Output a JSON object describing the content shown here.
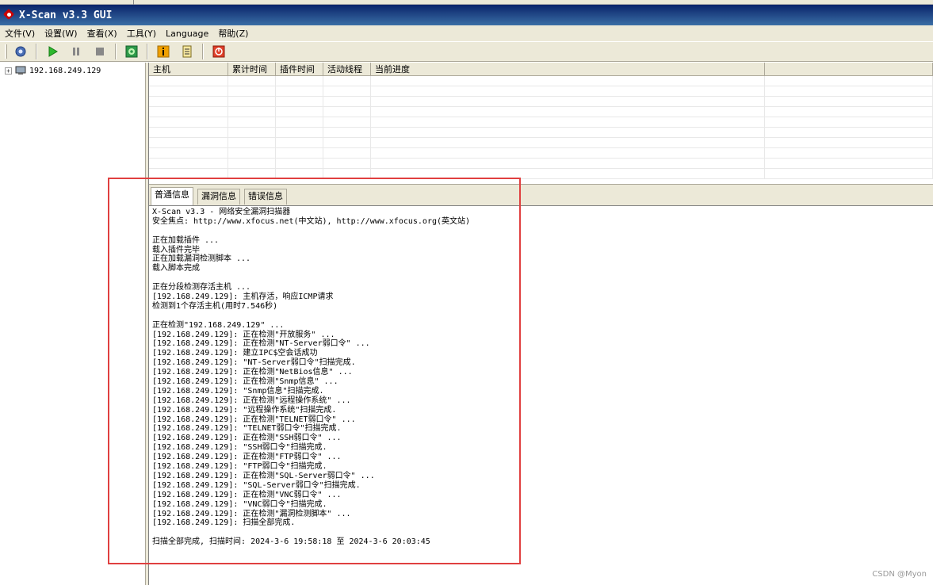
{
  "window": {
    "title": "X-Scan v3.3 GUI"
  },
  "menu": [
    "文件(V)",
    "设置(W)",
    "查看(X)",
    "工具(Y)",
    "Language",
    "帮助(Z)"
  ],
  "toolbar_icons": [
    "connect-icon",
    "play-icon",
    "pause-icon",
    "stop-icon",
    "plugin-icon",
    "info-icon",
    "report-icon",
    "exit-icon"
  ],
  "tree": {
    "host": "192.168.249.129"
  },
  "grid": {
    "columns": [
      "主机",
      "累计时间",
      "插件时间",
      "活动线程",
      "当前进度"
    ]
  },
  "tabs": [
    "普通信息",
    "漏洞信息",
    "错误信息"
  ],
  "log": [
    "X-Scan v3.3 - 网络安全漏洞扫描器",
    "安全焦点: http://www.xfocus.net(中文站), http://www.xfocus.org(英文站)",
    "",
    "正在加载插件 ...",
    "载入插件完毕",
    "正在加载漏洞检测脚本 ...",
    "载入脚本完成",
    "",
    "正在分段检测存活主机 ...",
    "[192.168.249.129]: 主机存活，响应ICMP请求",
    "检测到1个存活主机(用时7.546秒)",
    "",
    "正在检测\"192.168.249.129\" ...",
    "[192.168.249.129]: 正在检测\"开放服务\" ...",
    "[192.168.249.129]: 正在检测\"NT-Server弱口令\" ...",
    "[192.168.249.129]: 建立IPC$空会话成功",
    "[192.168.249.129]: \"NT-Server弱口令\"扫描完成.",
    "[192.168.249.129]: 正在检测\"NetBios信息\" ...",
    "[192.168.249.129]: 正在检测\"Snmp信息\" ...",
    "[192.168.249.129]: \"Snmp信息\"扫描完成.",
    "[192.168.249.129]: 正在检测\"远程操作系统\" ...",
    "[192.168.249.129]: \"远程操作系统\"扫描完成.",
    "[192.168.249.129]: 正在检测\"TELNET弱口令\" ...",
    "[192.168.249.129]: \"TELNET弱口令\"扫描完成.",
    "[192.168.249.129]: 正在检测\"SSH弱口令\" ...",
    "[192.168.249.129]: \"SSH弱口令\"扫描完成.",
    "[192.168.249.129]: 正在检测\"FTP弱口令\" ...",
    "[192.168.249.129]: \"FTP弱口令\"扫描完成.",
    "[192.168.249.129]: 正在检测\"SQL-Server弱口令\" ...",
    "[192.168.249.129]: \"SQL-Server弱口令\"扫描完成.",
    "[192.168.249.129]: 正在检测\"VNC弱口令\" ...",
    "[192.168.249.129]: \"VNC弱口令\"扫描完成.",
    "[192.168.249.129]: 正在检测\"漏洞检测脚本\" ...",
    "[192.168.249.129]: 扫描全部完成.",
    "",
    "扫描全部完成, 扫描时间: 2024-3-6 19:58:18 至 2024-3-6 20:03:45"
  ],
  "watermark": "CSDN @Myon⁠"
}
